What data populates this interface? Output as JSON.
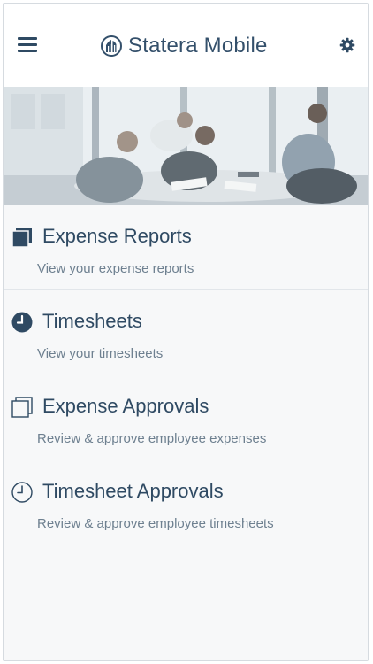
{
  "header": {
    "title": "Statera Mobile",
    "menu_icon": "hamburger-menu-icon",
    "logo_icon": "statera-logo-icon",
    "settings_icon": "gear-icon"
  },
  "hero": {
    "image": "office-meeting-photo"
  },
  "menu": {
    "items": [
      {
        "title": "Expense Reports",
        "subtitle": "View your expense reports",
        "icon": "filled-stacked-squares-icon"
      },
      {
        "title": "Timesheets",
        "subtitle": "View your timesheets",
        "icon": "filled-clock-icon"
      },
      {
        "title": "Expense Approvals",
        "subtitle": "Review & approve employee expenses",
        "icon": "outline-stacked-squares-icon"
      },
      {
        "title": "Timesheet Approvals",
        "subtitle": "Review & approve employee timesheets",
        "icon": "outline-clock-icon"
      }
    ]
  },
  "colors": {
    "primary": "#2f4a63",
    "subtitle": "#6e8090",
    "background": "#f7f8f9",
    "divider": "#e2e6ea"
  }
}
